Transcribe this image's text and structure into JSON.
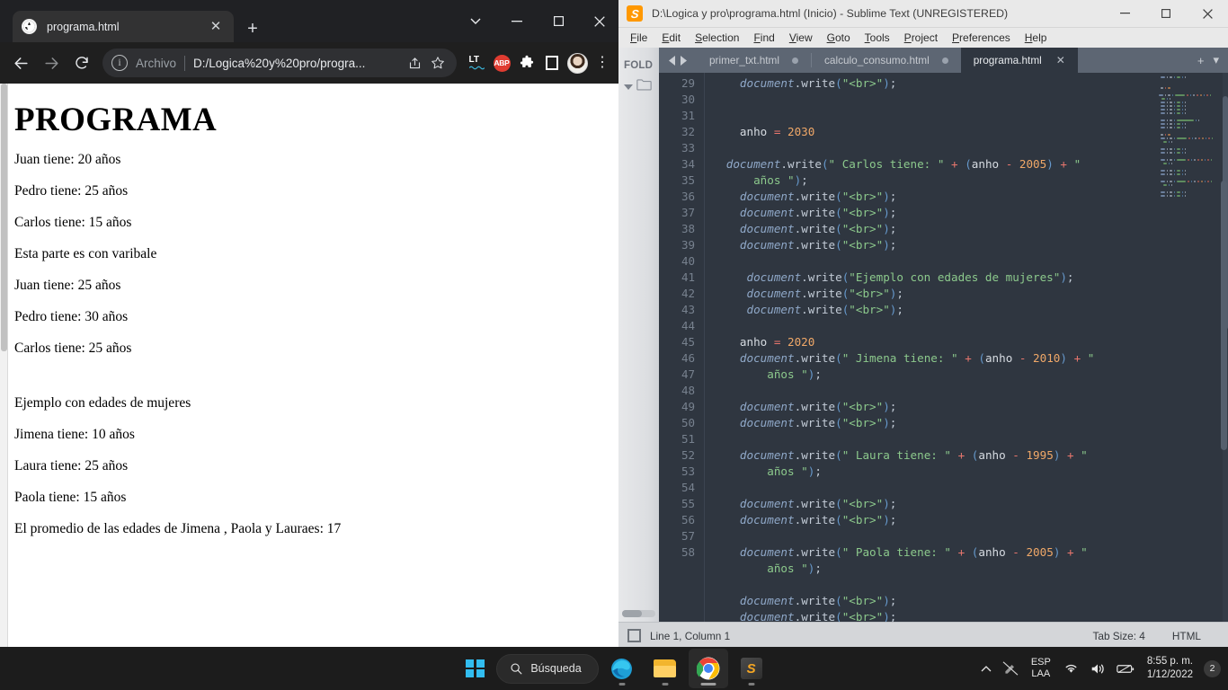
{
  "browser": {
    "tab": {
      "title": "programa.html",
      "favicon": "globe-icon",
      "close": "✕"
    },
    "new_tab": "+",
    "window_controls": {
      "minimize_chevron": "⌄",
      "minimize": "─",
      "maximize": "□",
      "close": "✕"
    },
    "nav": {
      "back": "←",
      "forward": "→",
      "reload": "↻"
    },
    "omnibox": {
      "info_icon": "i",
      "scheme_label": "Archivo",
      "url": "D:/Logica%20y%20pro/progra...",
      "share_icon": "share-icon",
      "bookmark_icon": "star-icon"
    },
    "extensions": [
      {
        "name": "languagetool-extension",
        "label": "LT"
      },
      {
        "name": "adblock-plus-extension",
        "label": "ABP"
      },
      {
        "name": "extensions-puzzle-icon",
        "label": ""
      },
      {
        "name": "square-extension",
        "label": ""
      }
    ],
    "profile": "profile-avatar",
    "menu": "⋮"
  },
  "page": {
    "heading": "PROGRAMA",
    "lines": [
      "Juan tiene: 20 años",
      "Pedro tiene: 25 años",
      "Carlos tiene: 15 años",
      "Esta parte es con varibale",
      "Juan tiene: 25 años",
      "Pedro tiene: 30 años",
      "Carlos tiene: 25 años",
      "",
      "Ejemplo con edades de mujeres",
      "Jimena tiene: 10 años",
      "Laura tiene: 25 años",
      "Paola tiene: 15 años",
      "El promedio de las edades de Jimena , Paola y Lauraes: 17"
    ]
  },
  "sublime": {
    "title": "D:\\Logica y pro\\programa.html (Inicio) - Sublime Text (UNREGISTERED)",
    "window_controls": {
      "minimize": "─",
      "maximize": "□",
      "close": "✕"
    },
    "menu": [
      "File",
      "Edit",
      "Selection",
      "Find",
      "View",
      "Goto",
      "Tools",
      "Project",
      "Preferences",
      "Help"
    ],
    "sidebar": {
      "header": "FOLD",
      "folder_icon": "folder-icon"
    },
    "tabs": [
      {
        "label": "primer_txt.html",
        "dirty": true,
        "active": false
      },
      {
        "label": "calculo_consumo.html",
        "dirty": true,
        "active": false
      },
      {
        "label": "programa.html",
        "dirty": false,
        "active": true,
        "close": "✕"
      }
    ],
    "tabs_right": {
      "new_tab": "+",
      "dropdown": "▾"
    },
    "line_numbers": [
      29,
      30,
      31,
      32,
      33,
      34,
      "",
      35,
      36,
      37,
      38,
      39,
      40,
      41,
      42,
      43,
      44,
      45,
      "",
      46,
      47,
      48,
      49,
      50,
      "",
      51,
      52,
      53,
      54,
      55,
      "",
      56,
      57,
      58
    ],
    "code_lines": [
      {
        "n": "29",
        "indent": 5,
        "tokens": [
          [
            "obj",
            "document"
          ],
          [
            "punc",
            "."
          ],
          [
            "fn",
            "write"
          ],
          [
            "paren",
            "("
          ],
          [
            "str",
            "\"<br>\""
          ],
          [
            "paren",
            ")"
          ],
          [
            "punc",
            ";"
          ]
        ]
      },
      {
        "n": "30",
        "indent": 0,
        "tokens": []
      },
      {
        "n": "31",
        "indent": 0,
        "tokens": []
      },
      {
        "n": "32",
        "indent": 5,
        "tokens": [
          [
            "var",
            "anho "
          ],
          [
            "op",
            "="
          ],
          [
            "num",
            " 2030"
          ]
        ]
      },
      {
        "n": "33",
        "indent": 0,
        "tokens": []
      },
      {
        "n": "34",
        "indent": 3,
        "tokens": [
          [
            "obj",
            "document"
          ],
          [
            "punc",
            "."
          ],
          [
            "fn",
            "write"
          ],
          [
            "paren",
            "("
          ],
          [
            "str",
            "\" Carlos tiene: \""
          ],
          [
            "op",
            " + "
          ],
          [
            "paren",
            "("
          ],
          [
            "var",
            "anho"
          ],
          [
            "op",
            " - "
          ],
          [
            "num",
            "2005"
          ],
          [
            "paren",
            ")"
          ],
          [
            "op",
            " + "
          ],
          [
            "str",
            "\""
          ]
        ]
      },
      {
        "n": "",
        "indent": 7,
        "tokens": [
          [
            "str",
            "años \""
          ],
          [
            "paren",
            ")"
          ],
          [
            "punc",
            ";"
          ]
        ]
      },
      {
        "n": "35",
        "indent": 5,
        "tokens": [
          [
            "obj",
            "document"
          ],
          [
            "punc",
            "."
          ],
          [
            "fn",
            "write"
          ],
          [
            "paren",
            "("
          ],
          [
            "str",
            "\"<br>\""
          ],
          [
            "paren",
            ")"
          ],
          [
            "punc",
            ";"
          ]
        ]
      },
      {
        "n": "36",
        "indent": 5,
        "tokens": [
          [
            "obj",
            "document"
          ],
          [
            "punc",
            "."
          ],
          [
            "fn",
            "write"
          ],
          [
            "paren",
            "("
          ],
          [
            "str",
            "\"<br>\""
          ],
          [
            "paren",
            ")"
          ],
          [
            "punc",
            ";"
          ]
        ]
      },
      {
        "n": "37",
        "indent": 5,
        "tokens": [
          [
            "obj",
            "document"
          ],
          [
            "punc",
            "."
          ],
          [
            "fn",
            "write"
          ],
          [
            "paren",
            "("
          ],
          [
            "str",
            "\"<br>\""
          ],
          [
            "paren",
            ")"
          ],
          [
            "punc",
            ";"
          ]
        ]
      },
      {
        "n": "38",
        "indent": 5,
        "tokens": [
          [
            "obj",
            "document"
          ],
          [
            "punc",
            "."
          ],
          [
            "fn",
            "write"
          ],
          [
            "paren",
            "("
          ],
          [
            "str",
            "\"<br>\""
          ],
          [
            "paren",
            ")"
          ],
          [
            "punc",
            ";"
          ]
        ]
      },
      {
        "n": "39",
        "indent": 0,
        "tokens": []
      },
      {
        "n": "40",
        "indent": 6,
        "tokens": [
          [
            "obj",
            "document"
          ],
          [
            "punc",
            "."
          ],
          [
            "fn",
            "write"
          ],
          [
            "paren",
            "("
          ],
          [
            "str",
            "\"Ejemplo con edades de mujeres\""
          ],
          [
            "paren",
            ")"
          ],
          [
            "punc",
            ";"
          ]
        ]
      },
      {
        "n": "41",
        "indent": 6,
        "tokens": [
          [
            "obj",
            "document"
          ],
          [
            "punc",
            "."
          ],
          [
            "fn",
            "write"
          ],
          [
            "paren",
            "("
          ],
          [
            "str",
            "\"<br>\""
          ],
          [
            "paren",
            ")"
          ],
          [
            "punc",
            ";"
          ]
        ]
      },
      {
        "n": "42",
        "indent": 6,
        "tokens": [
          [
            "obj",
            "document"
          ],
          [
            "punc",
            "."
          ],
          [
            "fn",
            "write"
          ],
          [
            "paren",
            "("
          ],
          [
            "str",
            "\"<br>\""
          ],
          [
            "paren",
            ")"
          ],
          [
            "punc",
            ";"
          ]
        ]
      },
      {
        "n": "43",
        "indent": 0,
        "tokens": []
      },
      {
        "n": "44",
        "indent": 5,
        "tokens": [
          [
            "var",
            "anho "
          ],
          [
            "op",
            "="
          ],
          [
            "num",
            " 2020"
          ]
        ]
      },
      {
        "n": "45",
        "indent": 5,
        "tokens": [
          [
            "obj",
            "document"
          ],
          [
            "punc",
            "."
          ],
          [
            "fn",
            "write"
          ],
          [
            "paren",
            "("
          ],
          [
            "str",
            "\" Jimena tiene: \""
          ],
          [
            "op",
            " + "
          ],
          [
            "paren",
            "("
          ],
          [
            "var",
            "anho"
          ],
          [
            "op",
            " - "
          ],
          [
            "num",
            "2010"
          ],
          [
            "paren",
            ")"
          ],
          [
            "op",
            " + "
          ],
          [
            "str",
            "\""
          ]
        ]
      },
      {
        "n": "",
        "indent": 9,
        "tokens": [
          [
            "str",
            "años \""
          ],
          [
            "paren",
            ")"
          ],
          [
            "punc",
            ";"
          ]
        ]
      },
      {
        "n": "46",
        "indent": 0,
        "tokens": []
      },
      {
        "n": "47",
        "indent": 5,
        "tokens": [
          [
            "obj",
            "document"
          ],
          [
            "punc",
            "."
          ],
          [
            "fn",
            "write"
          ],
          [
            "paren",
            "("
          ],
          [
            "str",
            "\"<br>\""
          ],
          [
            "paren",
            ")"
          ],
          [
            "punc",
            ";"
          ]
        ]
      },
      {
        "n": "48",
        "indent": 5,
        "tokens": [
          [
            "obj",
            "document"
          ],
          [
            "punc",
            "."
          ],
          [
            "fn",
            "write"
          ],
          [
            "paren",
            "("
          ],
          [
            "str",
            "\"<br>\""
          ],
          [
            "paren",
            ")"
          ],
          [
            "punc",
            ";"
          ]
        ]
      },
      {
        "n": "49",
        "indent": 0,
        "tokens": []
      },
      {
        "n": "50",
        "indent": 5,
        "tokens": [
          [
            "obj",
            "document"
          ],
          [
            "punc",
            "."
          ],
          [
            "fn",
            "write"
          ],
          [
            "paren",
            "("
          ],
          [
            "str",
            "\" Laura tiene: \""
          ],
          [
            "op",
            " + "
          ],
          [
            "paren",
            "("
          ],
          [
            "var",
            "anho"
          ],
          [
            "op",
            " - "
          ],
          [
            "num",
            "1995"
          ],
          [
            "paren",
            ")"
          ],
          [
            "op",
            " + "
          ],
          [
            "str",
            "\""
          ]
        ]
      },
      {
        "n": "",
        "indent": 9,
        "tokens": [
          [
            "str",
            "años \""
          ],
          [
            "paren",
            ")"
          ],
          [
            "punc",
            ";"
          ]
        ]
      },
      {
        "n": "51",
        "indent": 0,
        "tokens": []
      },
      {
        "n": "52",
        "indent": 5,
        "tokens": [
          [
            "obj",
            "document"
          ],
          [
            "punc",
            "."
          ],
          [
            "fn",
            "write"
          ],
          [
            "paren",
            "("
          ],
          [
            "str",
            "\"<br>\""
          ],
          [
            "paren",
            ")"
          ],
          [
            "punc",
            ";"
          ]
        ]
      },
      {
        "n": "53",
        "indent": 5,
        "tokens": [
          [
            "obj",
            "document"
          ],
          [
            "punc",
            "."
          ],
          [
            "fn",
            "write"
          ],
          [
            "paren",
            "("
          ],
          [
            "str",
            "\"<br>\""
          ],
          [
            "paren",
            ")"
          ],
          [
            "punc",
            ";"
          ]
        ]
      },
      {
        "n": "54",
        "indent": 0,
        "tokens": []
      },
      {
        "n": "55",
        "indent": 5,
        "tokens": [
          [
            "obj",
            "document"
          ],
          [
            "punc",
            "."
          ],
          [
            "fn",
            "write"
          ],
          [
            "paren",
            "("
          ],
          [
            "str",
            "\" Paola tiene: \""
          ],
          [
            "op",
            " + "
          ],
          [
            "paren",
            "("
          ],
          [
            "var",
            "anho"
          ],
          [
            "op",
            " - "
          ],
          [
            "num",
            "2005"
          ],
          [
            "paren",
            ")"
          ],
          [
            "op",
            " + "
          ],
          [
            "str",
            "\""
          ]
        ]
      },
      {
        "n": "",
        "indent": 9,
        "tokens": [
          [
            "str",
            "años \""
          ],
          [
            "paren",
            ")"
          ],
          [
            "punc",
            ";"
          ]
        ]
      },
      {
        "n": "56",
        "indent": 0,
        "tokens": []
      },
      {
        "n": "57",
        "indent": 5,
        "tokens": [
          [
            "obj",
            "document"
          ],
          [
            "punc",
            "."
          ],
          [
            "fn",
            "write"
          ],
          [
            "paren",
            "("
          ],
          [
            "str",
            "\"<br>\""
          ],
          [
            "paren",
            ")"
          ],
          [
            "punc",
            ";"
          ]
        ]
      },
      {
        "n": "58",
        "indent": 5,
        "tokens": [
          [
            "obj",
            "document"
          ],
          [
            "punc",
            "."
          ],
          [
            "fn",
            "write"
          ],
          [
            "paren",
            "("
          ],
          [
            "str",
            "\"<br>\""
          ],
          [
            "paren",
            ")"
          ],
          [
            "punc",
            ";"
          ]
        ]
      }
    ],
    "status": {
      "position": "Line 1, Column 1",
      "tab_size": "Tab Size: 4",
      "syntax": "HTML"
    }
  },
  "taskbar": {
    "start": "start-button",
    "search_placeholder": "Búsqueda",
    "apps": [
      {
        "name": "edge",
        "active": false
      },
      {
        "name": "file-explorer",
        "active": false
      },
      {
        "name": "chrome",
        "active": true
      },
      {
        "name": "sublime-text",
        "active": false
      }
    ],
    "tray": {
      "chevron": "⌃",
      "language_top": "ESP",
      "language_bottom": "LAA",
      "time": "8:55 p. m.",
      "date": "1/12/2022",
      "notification_count": "2"
    }
  },
  "colors": {
    "chrome_bg": "#1f1f1f",
    "sublime_bg": "#2f3640",
    "sublime_tabbar": "#5d6673",
    "accent_orange": "#f0a868",
    "string_green": "#8cc98c",
    "taskbar": "#1c1c1c"
  }
}
